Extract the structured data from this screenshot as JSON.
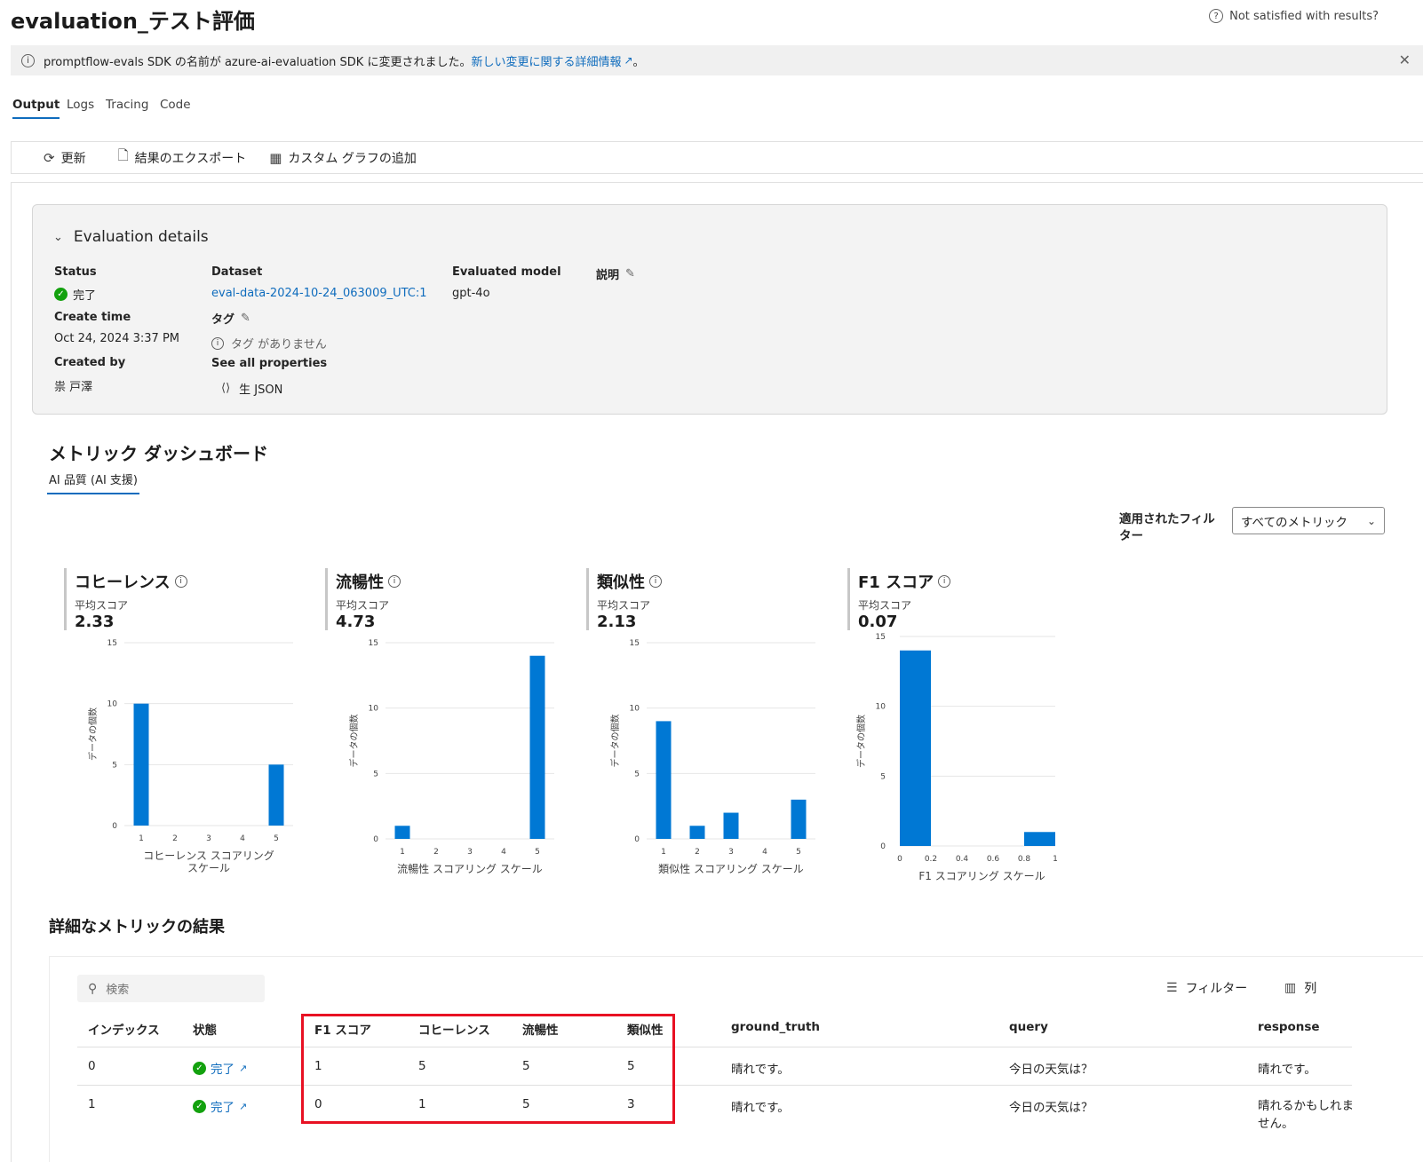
{
  "header": {
    "title": "evaluation_テスト評価",
    "help_text": "Not satisfied with results?"
  },
  "banner": {
    "text": "promptflow-evals SDK の名前が azure-ai-evaluation SDK に変更されました。",
    "link_text": "新しい変更に関する詳細情報",
    "suffix": "。"
  },
  "tabs": [
    "Output",
    "Logs",
    "Tracing",
    "Code"
  ],
  "toolbar": {
    "refresh": "更新",
    "export": "結果のエクスポート",
    "add_chart": "カスタム グラフの追加"
  },
  "details": {
    "header": "Evaluation details",
    "status_label": "Status",
    "status_value": "完了",
    "create_time_label": "Create time",
    "create_time_value": "Oct 24, 2024 3:37 PM",
    "created_by_label": "Created by",
    "created_by_value": "祟 戸澤",
    "dataset_label": "Dataset",
    "dataset_value": "eval-data-2024-10-24_063009_UTC:1",
    "tags_label": "タグ",
    "tags_empty": "タグ がありません",
    "properties_label": "See all properties",
    "raw_json": "生 JSON",
    "model_label": "Evaluated model",
    "model_value": "gpt-4o",
    "description_label": "説明"
  },
  "dashboard": {
    "title": "メトリック ダッシュボード",
    "tab": "AI 品質 (AI 支援)",
    "filter_label": "適用されたフィルター",
    "filter_value": "すべてのメトリック",
    "avg_label": "平均スコア",
    "ylabel": "データの個数"
  },
  "chart_data": [
    {
      "type": "bar",
      "title": "コヒーレンス",
      "average": "2.33",
      "xlabel": "コヒーレンス スコアリング スケール",
      "ylabel": "データの個数",
      "categories": [
        "1",
        "2",
        "3",
        "4",
        "5"
      ],
      "values": [
        10,
        0,
        0,
        0,
        5
      ],
      "ylim": [
        0,
        15
      ],
      "yticks": [
        "0",
        "5",
        "10",
        "15"
      ]
    },
    {
      "type": "bar",
      "title": "流暢性",
      "average": "4.73",
      "xlabel": "流暢性 スコアリング スケール",
      "ylabel": "データの個数",
      "categories": [
        "1",
        "2",
        "3",
        "4",
        "5"
      ],
      "values": [
        1,
        0,
        0,
        0,
        14
      ],
      "ylim": [
        0,
        15
      ],
      "yticks": [
        "0",
        "5",
        "10",
        "15"
      ]
    },
    {
      "type": "bar",
      "title": "類似性",
      "average": "2.13",
      "xlabel": "類似性 スコアリング スケール",
      "ylabel": "データの個数",
      "categories": [
        "1",
        "2",
        "3",
        "4",
        "5"
      ],
      "values": [
        9,
        1,
        2,
        0,
        3
      ],
      "ylim": [
        0,
        15
      ],
      "yticks": [
        "0",
        "5",
        "10",
        "15"
      ]
    },
    {
      "type": "bar",
      "title": "F1 スコア",
      "average": "0.07",
      "xlabel": "F1 スコアリング スケール",
      "ylabel": "データの個数",
      "bins": [
        [
          0,
          0.2
        ],
        [
          0.8,
          1
        ]
      ],
      "values": [
        14,
        1
      ],
      "xticks": [
        "0",
        "0.2",
        "0.4",
        "0.6",
        "0.8",
        "1"
      ],
      "ylim": [
        0,
        15
      ],
      "yticks": [
        "0",
        "5",
        "10",
        "15"
      ]
    }
  ],
  "results": {
    "title": "詳細なメトリックの結果",
    "search_placeholder": "検索",
    "filter_button": "フィルター",
    "columns_button": "列",
    "headers": [
      "インデックス",
      "状態",
      "F1 スコア",
      "コヒーレンス",
      "流暢性",
      "類似性",
      "ground_truth",
      "query",
      "response"
    ],
    "rows": [
      [
        "0",
        "完了",
        "1",
        "5",
        "5",
        "5",
        "晴れです。",
        "今日の天気は？",
        "晴れです。"
      ],
      [
        "1",
        "完了",
        "0",
        "1",
        "5",
        "3",
        "晴れです。",
        "今日の天気は？",
        "晴れるかもしれません。"
      ]
    ]
  },
  "colors": {
    "accent": "#0f6cbd",
    "bar": "#0078d4",
    "success": "#13a10e",
    "highlight": "#e81123"
  }
}
